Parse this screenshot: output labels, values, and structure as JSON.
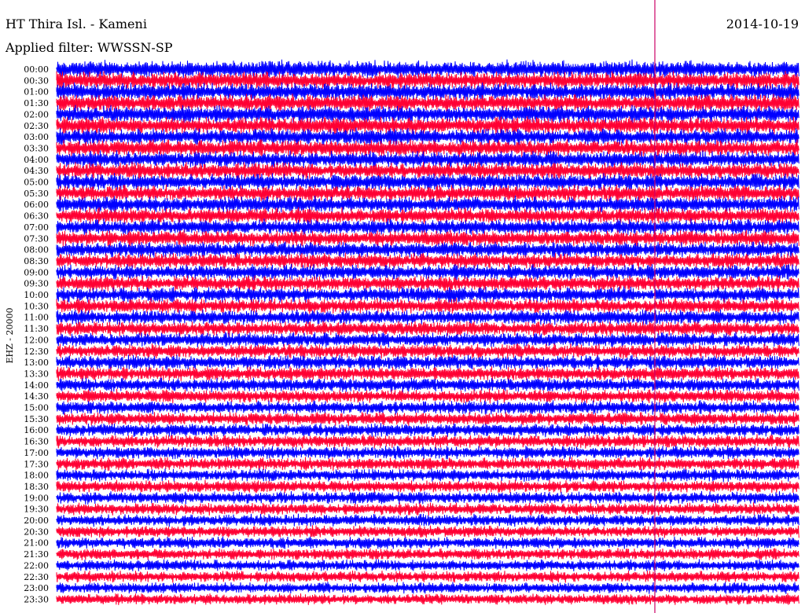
{
  "header": {
    "station": "HT Thira Isl. - Kameni",
    "date": "2014-10-19",
    "filter": "Applied filter: WWSSN-SP"
  },
  "chart_data": {
    "type": "line",
    "chart_kind": "helicorder seismogram",
    "title": "HT Thira Isl. - Kameni",
    "subtitle": "Applied filter: WWSSN-SP",
    "date": "2014-10-19",
    "ylabel": "EHZ - 20000",
    "row_labels": [
      "00:00",
      "00:30",
      "01:00",
      "01:30",
      "02:00",
      "02:30",
      "03:00",
      "03:30",
      "04:00",
      "04:30",
      "05:00",
      "05:30",
      "06:00",
      "06:30",
      "07:00",
      "07:30",
      "08:00",
      "08:30",
      "09:00",
      "09:30",
      "10:00",
      "10:30",
      "11:00",
      "11:30",
      "12:00",
      "12:30",
      "13:00",
      "13:30",
      "14:00",
      "14:30",
      "15:00",
      "15:30",
      "16:00",
      "16:30",
      "17:00",
      "17:30",
      "18:00",
      "18:30",
      "19:00",
      "19:30",
      "20:00",
      "20:30",
      "21:00",
      "21:30",
      "22:00",
      "22:30",
      "23:00",
      "23:30"
    ],
    "row_duration_minutes": 30,
    "trace_colors": [
      "#0000ff",
      "#ff0033"
    ],
    "marker_color": "#cc0066",
    "grid": false
  }
}
